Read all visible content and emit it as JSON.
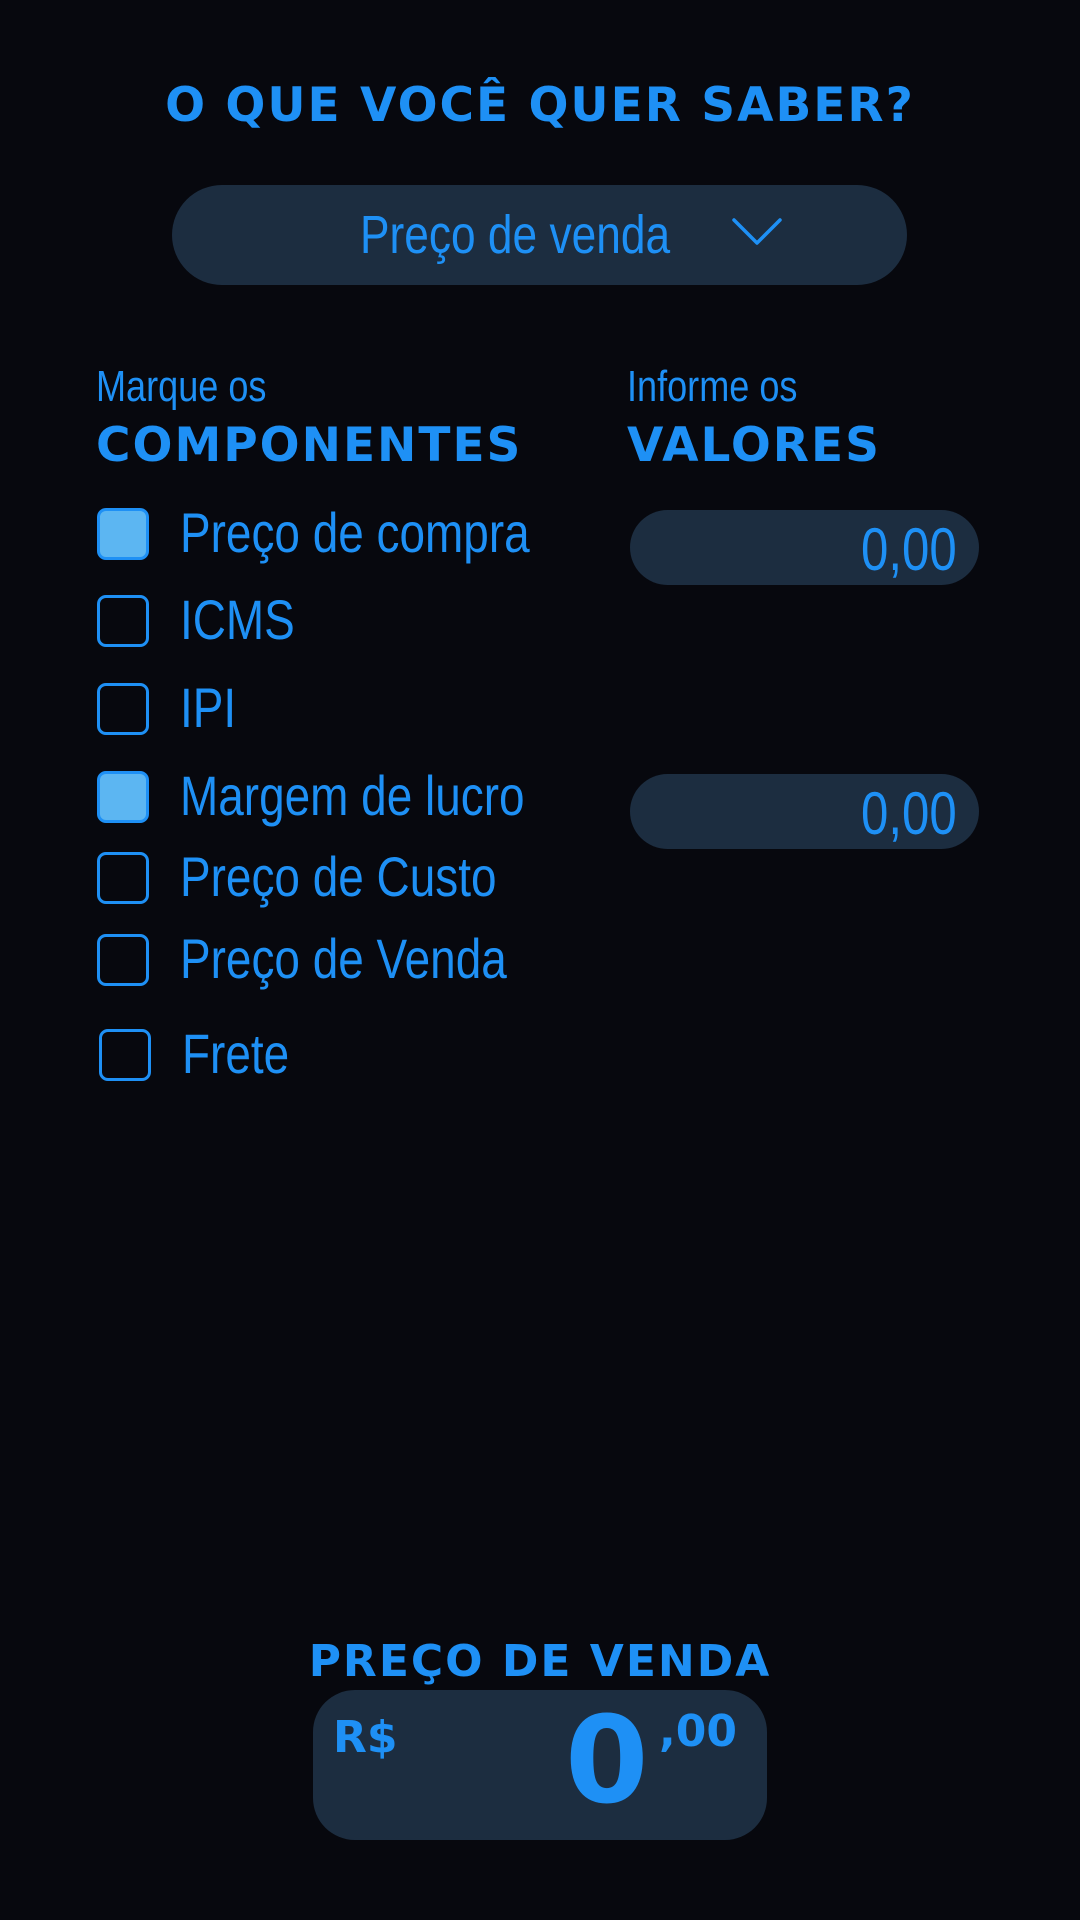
{
  "header": {
    "title": "O QUE VOCÊ QUER SABER?"
  },
  "calculation_select": {
    "selected": "Preço de venda",
    "icon": "chevron-down-icon"
  },
  "components": {
    "subtitle": "Marque os",
    "title": "COMPONENTES",
    "items": [
      {
        "label": "Preço de compra",
        "checked": true
      },
      {
        "label": "ICMS",
        "checked": false
      },
      {
        "label": "IPI",
        "checked": false
      },
      {
        "label": "Margem de lucro",
        "checked": true
      },
      {
        "label": "Preço de Custo",
        "checked": false
      },
      {
        "label": "Preço de Venda",
        "checked": false
      },
      {
        "label": "Frete",
        "checked": false
      }
    ]
  },
  "values": {
    "subtitle": "Informe os",
    "title": "VALORES",
    "fields": [
      {
        "for": "Preço de compra",
        "value": "0,00"
      },
      {
        "for": "Margem de lucro",
        "value": "0,00"
      }
    ]
  },
  "result": {
    "title": "PREÇO DE VENDA",
    "currency": "R$",
    "integer": "0",
    "decimal": ",00"
  },
  "colors": {
    "background": "#07080e",
    "accent": "#1e90f5",
    "field_bg": "#1c2d40",
    "checked_fill": "#5cb6f2"
  }
}
